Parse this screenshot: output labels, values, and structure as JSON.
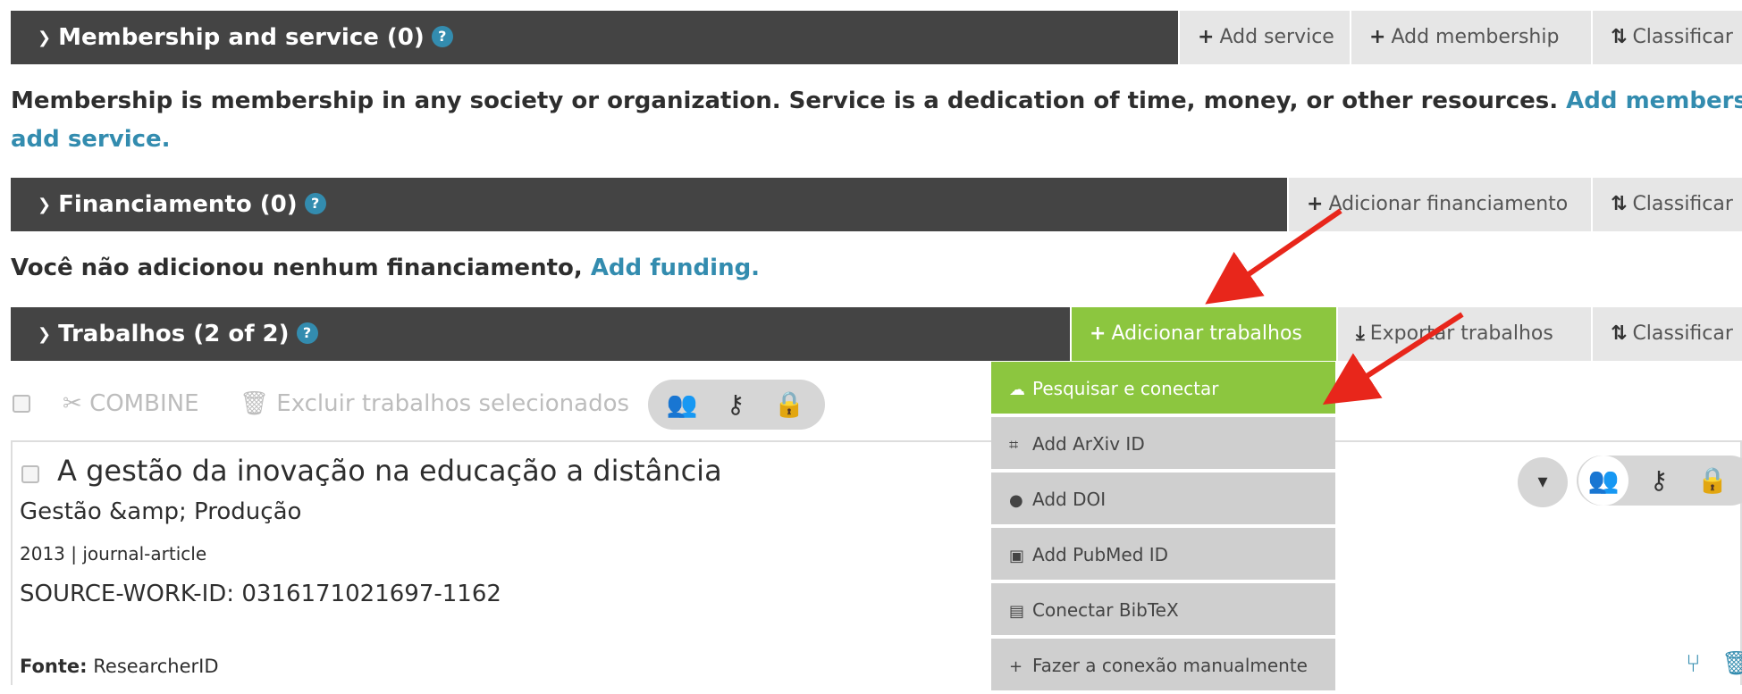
{
  "membership": {
    "title": "Membership and service (0)",
    "help": "?",
    "add_service": "Add service",
    "add_membership": "Add membership",
    "sort": "Classificar",
    "desc_text": "Membership is membership in any society or organization. Service is a dedication of time, money, or other resources.",
    "desc_link1": "Add membership",
    "desc_or": "or",
    "desc_link2": "add service."
  },
  "funding": {
    "title": "Financiamento (0)",
    "help": "?",
    "add": "Adicionar financiamento",
    "sort": "Classificar",
    "empty_text": "Você não adicionou nenhum financiamento,",
    "empty_link": "Add funding."
  },
  "works": {
    "title": "Trabalhos (2 of 2)",
    "help": "?",
    "add": "Adicionar trabalhos",
    "export": "Exportar trabalhos",
    "sort": "Classificar",
    "toolbar": {
      "combine": "COMBINE",
      "delete": "Excluir trabalhos selecionados"
    },
    "menu": [
      {
        "icon": "cloud-link-icon",
        "glyph": "☁",
        "label": "Pesquisar e conectar"
      },
      {
        "icon": "arxiv-icon",
        "glyph": "⌗",
        "label": "Add ArXiv ID"
      },
      {
        "icon": "doi-icon",
        "glyph": "●",
        "label": "Add DOI"
      },
      {
        "icon": "pubmed-icon",
        "glyph": "▣",
        "label": "Add PubMed ID"
      },
      {
        "icon": "bibtex-icon",
        "glyph": "▤",
        "label": "Conectar BibTeX"
      },
      {
        "icon": "plus-icon",
        "glyph": "+",
        "label": "Fazer a conexão manualmente"
      }
    ],
    "item": {
      "title": "A gestão da inovação na educação a distância",
      "journal": "Gestão &amp; Produção",
      "meta": "2013 | journal-article",
      "source_id": "SOURCE-WORK-ID: 0316171021697-1162",
      "source_label": "Fonte:",
      "source_value": "ResearcherID"
    }
  },
  "colors": {
    "bar": "#444444",
    "accent_green": "#8cc63f",
    "link_blue": "#338caf",
    "arrow_red": "#e8261b"
  }
}
